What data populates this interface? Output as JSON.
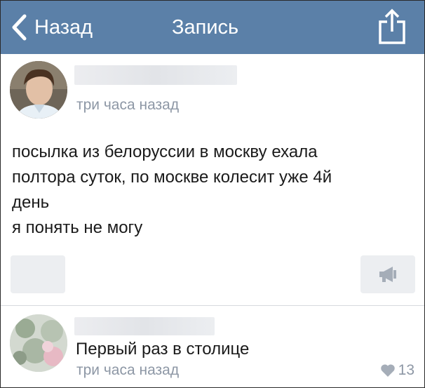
{
  "nav": {
    "back_label": "Назад",
    "title": "Запись",
    "bg_color": "#5b80a8",
    "icons": [
      "chevron-left-icon",
      "share-icon"
    ]
  },
  "post": {
    "time": "три часа назад",
    "text_lines": [
      "посылка из белоруссии в москву ехала",
      "полтора суток, по москве колесит уже 4й",
      "день",
      "я понять не могу"
    ],
    "icons": [
      "megaphone-icon"
    ]
  },
  "comment": {
    "text": "Первый раз в столице",
    "time": "три часа назад",
    "likes": "13",
    "icons": [
      "heart-icon"
    ]
  }
}
